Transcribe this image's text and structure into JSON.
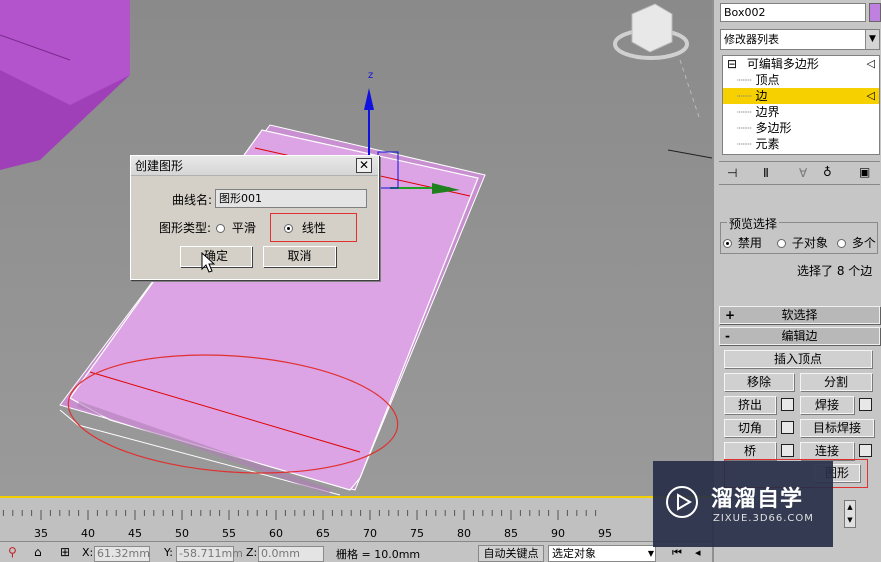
{
  "dialog": {
    "title": "创建图形",
    "close_glyph": "✕",
    "curve_name_label": "曲线名:",
    "curve_name_value": "图形001",
    "shape_type_label": "图形类型:",
    "option_smooth": "平滑",
    "option_linear": "线性",
    "selected_option": "线性",
    "ok_label": "确定",
    "cancel_label": "取消"
  },
  "panel": {
    "object_name": "Box002",
    "modifier_list": "修改器列表",
    "stack": [
      {
        "label": "可编辑多边形",
        "prefix": "⊟"
      },
      {
        "label": "顶点"
      },
      {
        "label": "边",
        "selected": true
      },
      {
        "label": "边界"
      },
      {
        "label": "多边形"
      },
      {
        "label": "元素"
      }
    ],
    "preview_selection_title": "预览选择",
    "preview_options": [
      "禁用",
      "子对象",
      "多个"
    ],
    "selection_info": "选择了 8 个边",
    "soft_select_label": "软选择",
    "edit_edges_label": "编辑边",
    "buttons": {
      "insert_vertex": "插入顶点",
      "remove": "移除",
      "split": "分割",
      "extrude": "挤出",
      "weld": "焊接",
      "chamfer": "切角",
      "target_weld": "目标焊接",
      "bridge": "桥",
      "connect": "连接",
      "create_shape": "图形"
    }
  },
  "timeline": {
    "ticks": [
      "35",
      "40",
      "45",
      "50",
      "55",
      "60",
      "65",
      "70",
      "75",
      "80",
      "85",
      "90",
      "95"
    ]
  },
  "status": {
    "x_label": "X:",
    "x_value": "61.32mm",
    "y_label": "Y:",
    "y_value": "-58.711mm",
    "z_label": "Z:",
    "z_value": "0.0mm",
    "grid_text": "栅格 = 10.0mm",
    "auto_key": "自动关键点",
    "selection_set": "选定对象"
  },
  "viewport": {
    "axis_label": "z"
  },
  "watermark": {
    "brand": "溜溜自学",
    "url": "ZIXUE.3D66.COM"
  },
  "colors": {
    "selection_yellow": "#f7d000",
    "object_purple": "#a040b8",
    "plane_pink": "#d8a0e0",
    "highlight_red": "#e03030"
  }
}
